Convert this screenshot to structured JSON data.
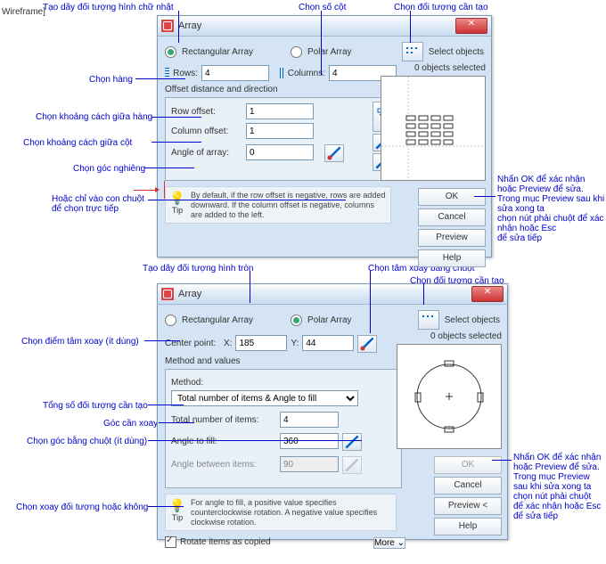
{
  "wireframe": "Wireframe]",
  "annotations": {
    "a1": "Tạo dãy đối tượng hình chữ nhật",
    "a2": "Chọn số cột",
    "a3": "Chọn đối tượng cần tạo",
    "a4": "Chọn hàng",
    "a5": "Chọn khoảng cách giữa hàng",
    "a6": "Chọn khoảng cách giữa cột",
    "a7": "Chọn góc nghiêng",
    "a8": "Hoặc chỉ vào con chuột\nđể chọn trực tiếp",
    "a9": "Nhấn OK để xác nhận\nhoặc Preview để sửa.\nTrong mục Preview sau khi\nsửa xong ta\nchọn nút phải chuột để xác\nnhận hoặc Esc\nđể sửa tiếp",
    "a10": "Tạo dãy đối tượng hình tròn",
    "a11": "Chọn tâm xoay bằng chuột",
    "a12": "Chọn đối tượng cần tạo",
    "a13": "Chọn điểm tâm xoay (ít dùng)",
    "a14": "Tổng số đối tượng cần tạo",
    "a15": "Góc cần xoay",
    "a16": "Chọn góc bằng chuột (ít dùng)",
    "a17": "Chọn xoay đối tượng hoặc không",
    "a18": "Nhấn OK để xác nhận\nhoặc Preview để sửa.\nTrong mục Preview\nsau khi sửa xong ta\nchọn nút phải chuột\nđể xác nhận hoặc Esc\nđể sửa tiếp"
  },
  "d1": {
    "title": "Array",
    "rect": "Rectangular Array",
    "polar": "Polar Array",
    "selobj": "Select objects",
    "selinfo": "0 objects selected",
    "rows": "Rows:",
    "rows_v": "4",
    "cols": "Columns:",
    "cols_v": "4",
    "group": "Offset distance and direction",
    "rowoff": "Row offset:",
    "rowoff_v": "1",
    "coloff": "Column offset:",
    "coloff_v": "1",
    "angle": "Angle of array:",
    "angle_v": "0",
    "tiplbl": "Tip",
    "tip": "By default, if the row offset is negative, rows are added downward. If the column offset is negative, columns are added to the left.",
    "ok": "OK",
    "cancel": "Cancel",
    "preview": "Preview",
    "help": "Help"
  },
  "d2": {
    "title": "Array",
    "rect": "Rectangular Array",
    "polar": "Polar Array",
    "selobj": "Select objects",
    "selinfo": "0 objects selected",
    "center": "Center point:",
    "x": "X:",
    "x_v": "185",
    "y": "Y:",
    "y_v": "44",
    "mv": "Method and values",
    "method": "Method:",
    "method_v": "Total number of items & Angle to fill",
    "total": "Total number of items:",
    "total_v": "4",
    "afill": "Angle to fill:",
    "afill_v": "360",
    "abet": "Angle between items:",
    "abet_v": "90",
    "tiplbl": "Tip",
    "tip": "For angle to fill, a positive value specifies counterclockwise rotation. A negative value specifies clockwise rotation.",
    "rotate": "Rotate items as copied",
    "more": "More  ⌄",
    "ok": "OK",
    "cancel": "Cancel",
    "preview": "Preview <",
    "help": "Help"
  }
}
